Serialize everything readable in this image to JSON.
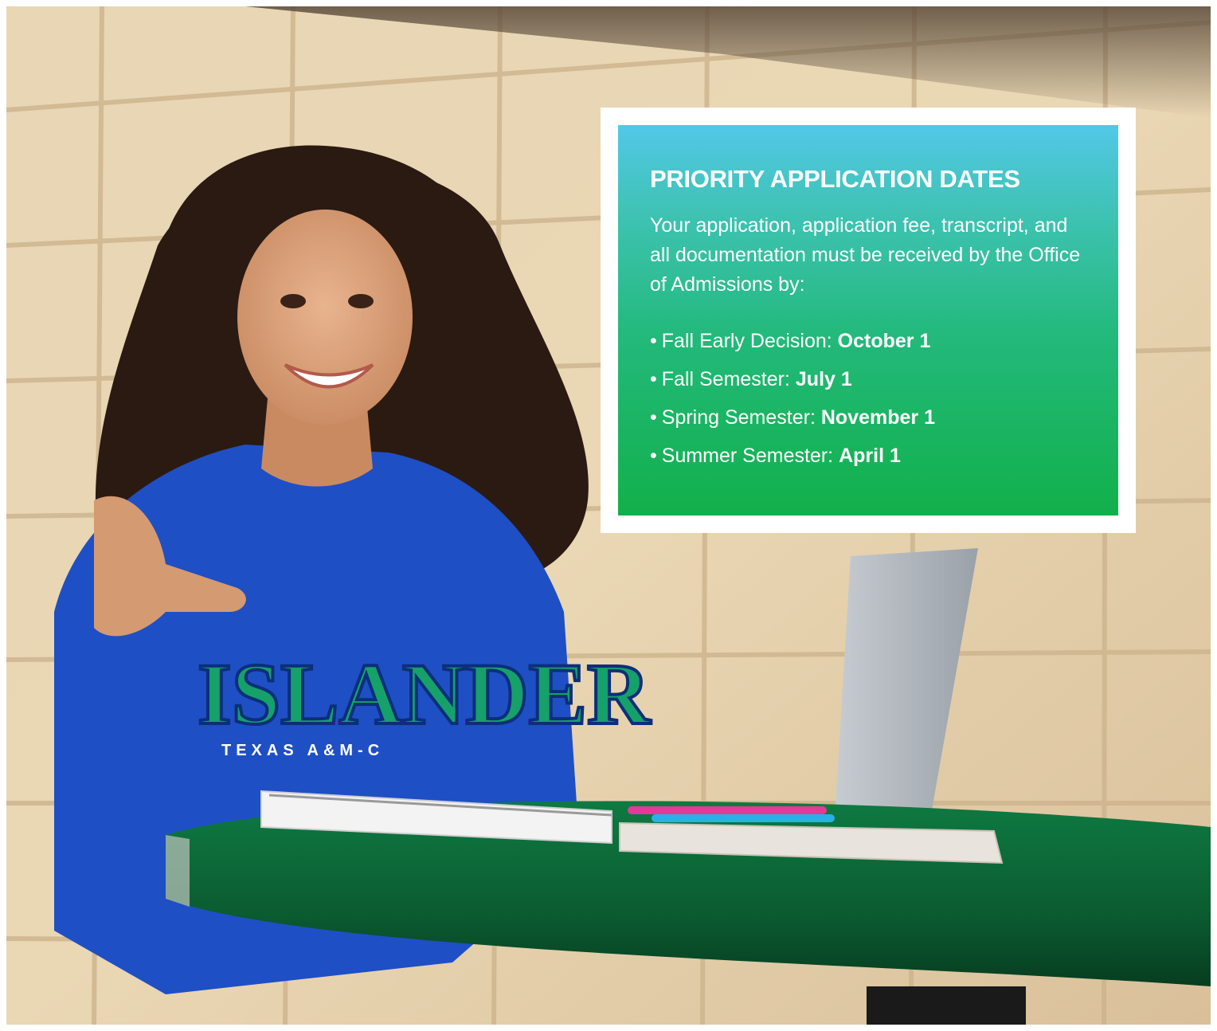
{
  "card": {
    "title": "PRIORITY APPLICATION DATES",
    "body": "Your application, application fee, transcript, and all documentation must be received by the Office of Admissions by:",
    "bullet": "•",
    "dates": [
      {
        "label": "Fall Early Decision:",
        "date": "October 1"
      },
      {
        "label": "Fall Semester:",
        "date": "July 1"
      },
      {
        "label": "Spring Semester:",
        "date": "November 1"
      },
      {
        "label": "Summer Semester:",
        "date": "April 1"
      }
    ]
  },
  "photo": {
    "shirt_text": "ISLANDER",
    "shirt_subtext": "TEXAS A&M-C"
  },
  "colors": {
    "gradient_top": "#52c8e8",
    "gradient_bottom": "#12b04a",
    "shirt_blue": "#1f4fc4",
    "table_green": "#0f6a3a",
    "wall": "#e3cda6"
  }
}
